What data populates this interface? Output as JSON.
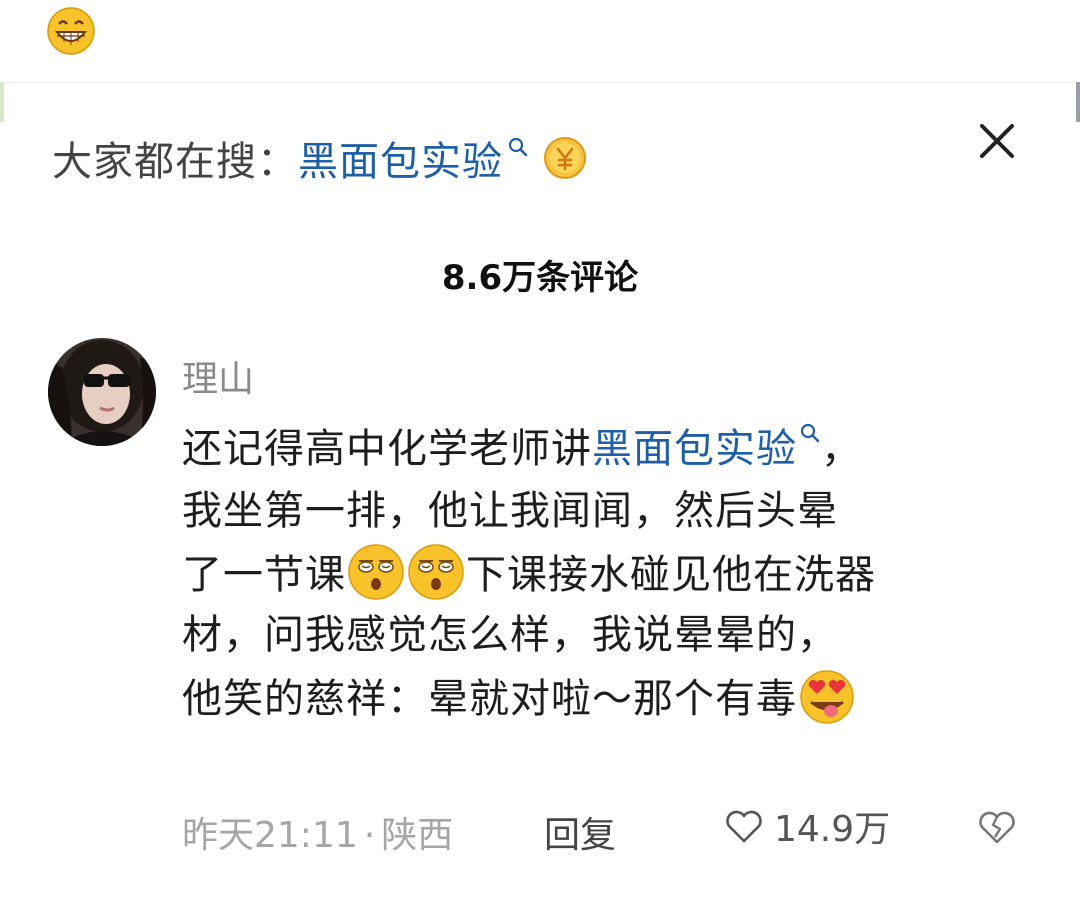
{
  "header": {
    "search_prefix": "大家都在搜：",
    "search_term": "黑面包实验"
  },
  "comments": {
    "count_label": "8.6万条评论"
  },
  "comment": {
    "username": "理山",
    "lines": [
      {
        "before": "还记得高中化学老师讲",
        "link": "黑面包实验",
        "after": "，"
      },
      {
        "text": "我坐第一排，他让我闻闻，然后头晕"
      },
      {
        "before": "了一节课",
        "after": "下课接水碰见他在洗器"
      },
      {
        "text": "材，问我感觉怎么样，我说晕晕的，"
      },
      {
        "text": "他笑的慈祥：晕就对啦～那个有毒"
      }
    ],
    "time": "昨天21:11",
    "separator": "·",
    "location": "陕西",
    "reply_label": "回复",
    "like_count": "14.9万"
  },
  "icons": {
    "top": "grinning-face-icon",
    "coin": "yuan-coin-icon",
    "close": "close-icon",
    "dazed": "dizzy-face-icon",
    "love": "heart-eyes-tongue-icon",
    "like": "heart-outline-icon",
    "dislike": "broken-heart-icon"
  },
  "colors": {
    "link": "#1f5fa8",
    "meta": "#a6a6a6",
    "emoji_yellow": "#f7c22a"
  }
}
